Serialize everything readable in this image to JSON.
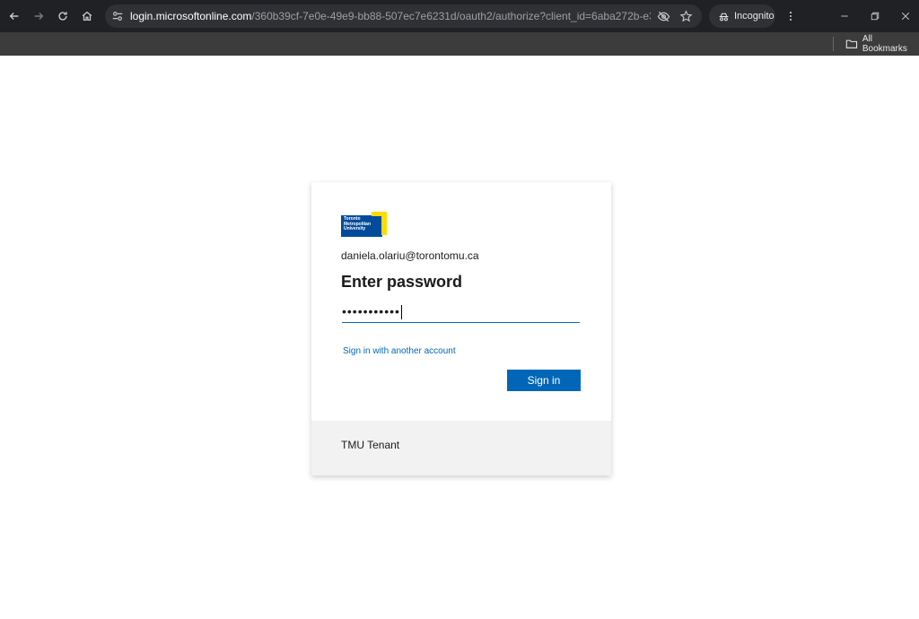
{
  "browser": {
    "url_host": "login.microsoftonline.com",
    "url_path": "/360b39cf-7e0e-49e9-bb88-507ec7e6231d/oauth2/authorize?client_id=6aba272b-e383-44cd-8...",
    "incognito_label": "Incognito",
    "all_bookmarks_label": "All Bookmarks"
  },
  "login": {
    "logo_text": "Toronto Metropolitan University",
    "email": "daniela.olariu@torontomu.ca",
    "title": "Enter password",
    "password_masked": "•••••••••••",
    "alt_account_link": "Sign in with another account",
    "signin_button": "Sign in",
    "tenant": "TMU Tenant"
  },
  "colors": {
    "accent": "#0067b8",
    "tmu_blue": "#004c9b",
    "tmu_yellow": "#ffdc00"
  }
}
